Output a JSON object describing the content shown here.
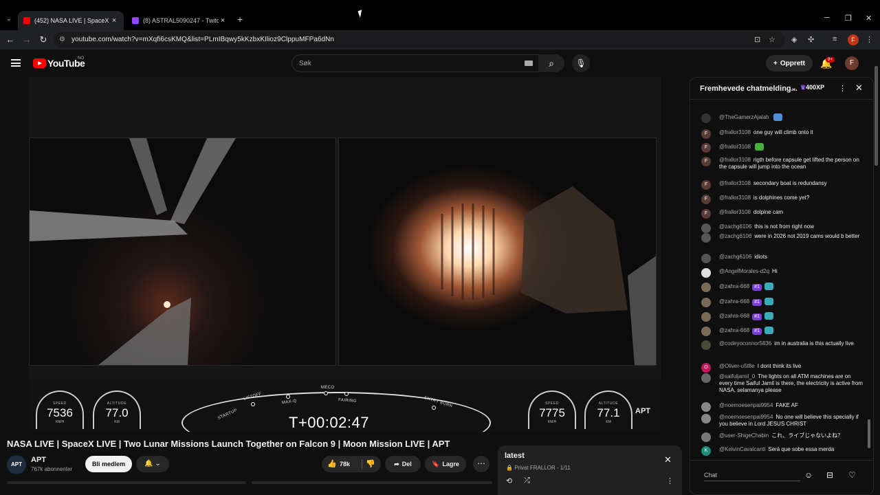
{
  "browser": {
    "tabs": [
      {
        "title": "(452) NASA LIVE | SpaceX LIVE |",
        "active": true,
        "favicon_color": "#ff0000"
      },
      {
        "title": "(8) ASTRAL5090247 - Twitch",
        "active": false,
        "favicon_color": "#9146ff"
      }
    ],
    "new_tab_icon": "+",
    "url": "youtube.com/watch?v=mXqfi6csKMQ&list=PLmIBqwy5kKzbxKIlioz9ClppuMFPa6dNn",
    "profile_initial": "F"
  },
  "masthead": {
    "logo_text": "YouTube",
    "country_code": "NO",
    "search_placeholder": "Søk",
    "create_label": "Opprett",
    "notif_count": "9+",
    "avatar_initial": "F"
  },
  "video": {
    "hud": {
      "left_speed_label": "SPEED",
      "left_speed": "7536",
      "left_speed_unit": "KM/H",
      "left_alt_label": "ALTITUDE",
      "left_alt": "77.0",
      "left_alt_unit": "KM",
      "right_speed_label": "SPEED",
      "right_speed": "7775",
      "right_speed_unit": "KM/H",
      "right_alt_label": "ALTITUDE",
      "right_alt": "77.1",
      "right_alt_unit": "KM",
      "milestones": [
        "STARTUP",
        "LIFTOFF",
        "MAX-Q",
        "MECO",
        "FAIRING",
        "ENTRY BURN"
      ],
      "clock": "T+00:02:47"
    },
    "watermark": "APT",
    "title": "NASA LIVE | SpaceX LIVE | Two Lunar Missions Launch Together on Falcon 9 | Moon Mission LIVE | APT",
    "channel": {
      "name": "APT",
      "subscribers": "767k abonnenter",
      "avatar_text": "APT"
    },
    "join_label": "Bli medlem",
    "likes": "78k",
    "share_label": "Del",
    "save_label": "Lagre"
  },
  "playlist": {
    "title": "latest",
    "subtitle": "Privat FRALLOR - 1/11"
  },
  "chat": {
    "header_title": "Fremhevede chatmelding...",
    "xp": "400XP",
    "input_placeholder": "Chat",
    "messages": [
      {
        "author": "@TheGamerzAjalah",
        "text": "",
        "avatar": "",
        "avatar_color": "#333",
        "emote": "#4a8fd6"
      },
      {
        "author": "@frallor3108",
        "text": "one guy will climb onto it",
        "avatar": "F",
        "avatar_color": "#5a3b35"
      },
      {
        "author": "@frallor3108",
        "text": "",
        "avatar": "F",
        "avatar_color": "#5a3b35",
        "emote": "#4cae3d"
      },
      {
        "author": "@frallor3108",
        "text": "rigth before capsule get lifted the person on the capsule will jump into the ocean",
        "avatar": "F",
        "avatar_color": "#5a3b35"
      },
      {
        "author": "@frallor3108",
        "text": "secondary boat is redundansy",
        "avatar": "F",
        "avatar_color": "#5a3b35"
      },
      {
        "author": "@frallor3108",
        "text": "is dolphines come yet?",
        "avatar": "F",
        "avatar_color": "#5a3b35"
      },
      {
        "author": "@frallor3108",
        "text": "dolpine cam",
        "avatar": "F",
        "avatar_color": "#5a3b35"
      },
      {
        "author": "@zachg6106",
        "text": "this is not from right now",
        "avatar": "",
        "avatar_color": "#555"
      },
      {
        "author": "@zachg6106",
        "text": "were in 2026 not 2019 cams would b better",
        "avatar": "",
        "avatar_color": "#555"
      },
      {
        "author": "@zachg6106",
        "text": "idiots",
        "avatar": "",
        "avatar_color": "#555"
      },
      {
        "author": "@AngelMorales-d2q",
        "text": "Hi",
        "avatar": "",
        "avatar_color": "#ddd"
      },
      {
        "author": "@zahra-668",
        "text": "",
        "avatar": "",
        "avatar_color": "#7a6a55",
        "rank": "#1",
        "emote": "#3aa9b8"
      },
      {
        "author": "@zahra-668",
        "text": "",
        "avatar": "",
        "avatar_color": "#7a6a55",
        "rank": "#1",
        "emote": "#3aa9b8"
      },
      {
        "author": "@zahra-668",
        "text": "",
        "avatar": "",
        "avatar_color": "#7a6a55",
        "rank": "#1",
        "emote": "#3aa9b8"
      },
      {
        "author": "@zahra-668",
        "text": "",
        "avatar": "",
        "avatar_color": "#7a6a55",
        "rank": "#1",
        "emote": "#3aa9b8"
      },
      {
        "author": "@codeyoconnor5836",
        "text": "im in australia is this actually live",
        "avatar": "",
        "avatar_color": "#4a4a3a"
      },
      {
        "author": "@Oliver-u5t8e",
        "text": "I dont think its live",
        "avatar": "O",
        "avatar_color": "#c2185b"
      },
      {
        "author": "@saifuljamil_0",
        "text": "The lights on all ATM machines are on every time Saiful Jamil is there, the electricity is active from NASA, selamanya please",
        "avatar": "",
        "avatar_color": "#666"
      },
      {
        "author": "@noemoesenpai9954",
        "text": "FAKE AF",
        "avatar": "",
        "avatar_color": "#888"
      },
      {
        "author": "@noemoesenpai9954",
        "text": "No one will believe this specially if you believe in Lord JESUS CHRIST",
        "avatar": "",
        "avatar_color": "#888"
      },
      {
        "author": "@user-ShigeChabin",
        "text": "これ、ライブじゃないよね？",
        "avatar": "",
        "avatar_color": "#777"
      },
      {
        "author": "@KelvinCavalcanti",
        "text": "Será que sobe essa merda",
        "avatar": "K",
        "avatar_color": "#1e8c7a"
      }
    ]
  }
}
